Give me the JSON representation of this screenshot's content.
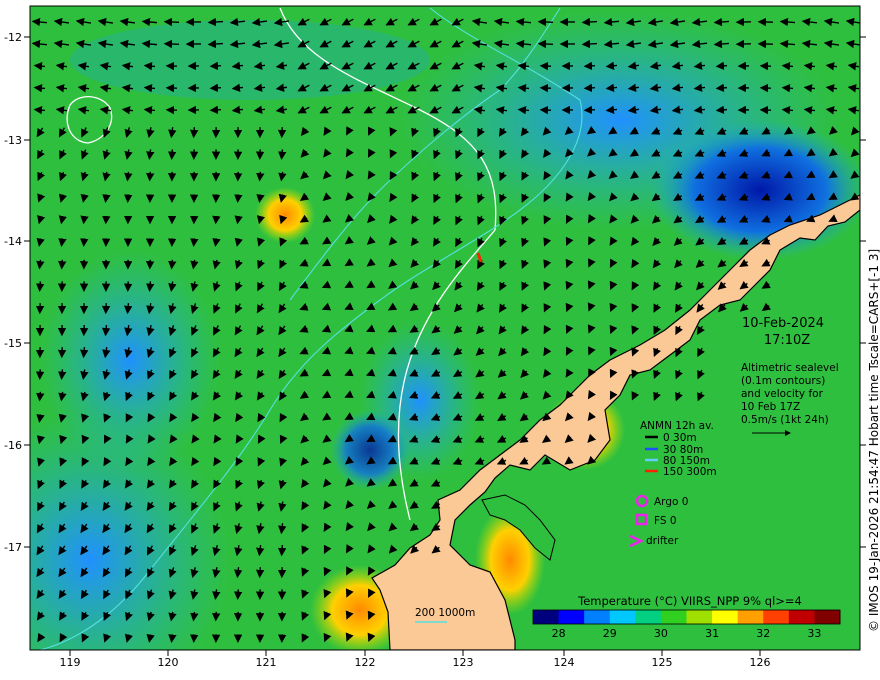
{
  "date": "10-Feb-2024",
  "time": "17:10Z",
  "altimetry_note": [
    "Altimetric sealevel",
    "(0.1m contours)",
    "and velocity for",
    "10 Feb 17Z",
    "0.5m/s (1kt 24h)"
  ],
  "anmn": {
    "title": "ANMN 12h av.",
    "items": [
      {
        "label": "0 30m",
        "color": "#000000"
      },
      {
        "label": "30 80m",
        "color": "#1f4fff"
      },
      {
        "label": "80 150m",
        "color": "#66ccff"
      },
      {
        "label": "150 300m",
        "color": "#ff2200"
      }
    ]
  },
  "symbols": [
    {
      "label": "Argo 0",
      "shape": "circle",
      "color": "#ee22ee"
    },
    {
      "label": "FS 0",
      "shape": "square",
      "color": "#ee22ee"
    },
    {
      "label": "drifter",
      "shape": "chevron",
      "color": "#ee22ee"
    }
  ],
  "bathymetry_label": "200  1000m",
  "colorbar": {
    "title": "Temperature (°C) VIIRS_NPP 9% ql>=4",
    "ticks": [
      "28",
      "29",
      "30",
      "31",
      "32",
      "33"
    ],
    "range": [
      27.5,
      33.5
    ],
    "colors": [
      "#00007f",
      "#0000ff",
      "#0080ff",
      "#00c8ff",
      "#00d080",
      "#30d020",
      "#a0e000",
      "#ffff00",
      "#ffa000",
      "#ff4000",
      "#c00000",
      "#800000"
    ]
  },
  "axes": {
    "x_ticks": [
      "119",
      "120",
      "121",
      "122",
      "123",
      "124",
      "125",
      "126"
    ],
    "y_ticks": [
      "-12",
      "-13",
      "-14",
      "-15",
      "-16",
      "-17"
    ],
    "lon_range": [
      118.6,
      126.9
    ],
    "lat_range": [
      -11.7,
      -17.95
    ]
  },
  "credit": "© IMOS 19-Jan-2026 21:54:47 Hobart time Tscale=CARS+[-1 3]"
}
